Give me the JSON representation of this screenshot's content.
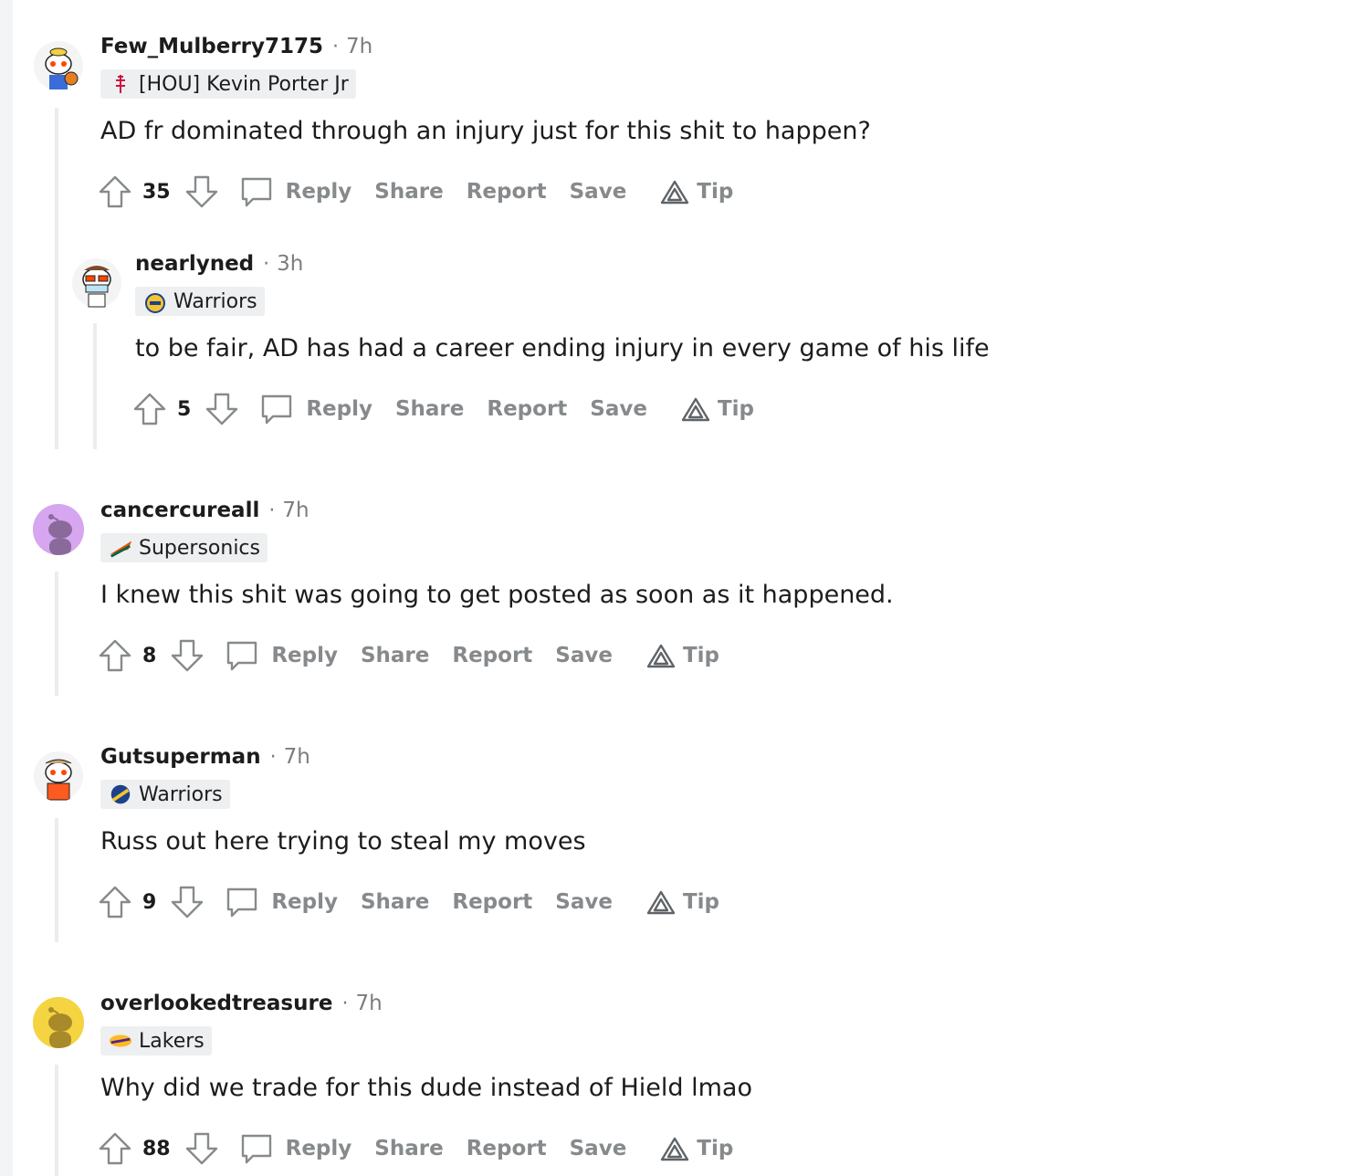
{
  "actions": {
    "reply": "Reply",
    "share": "Share",
    "report": "Report",
    "save": "Save",
    "tip": "Tip"
  },
  "comments": [
    {
      "username": "Few_Mulberry7175",
      "age": "7h",
      "flair": "[HOU] Kevin Porter Jr",
      "flair_icon": "rockets-logo-icon",
      "body": "AD fr dominated through an injury just for this shit to happen?",
      "score": "35",
      "avatar_color": "#ffffff"
    },
    {
      "username": "nearlyned",
      "age": "3h",
      "flair": "Warriors",
      "flair_icon": "bay-warriors-logo-icon",
      "body": "to be fair, AD has had a career ending injury in every game of his life",
      "score": "5",
      "avatar_color": "#ffffff"
    },
    {
      "username": "cancercureall",
      "age": "7h",
      "flair": "Supersonics",
      "flair_icon": "supersonics-logo-icon",
      "body": "I knew this shit was going to get posted as soon as it happened.",
      "score": "8",
      "avatar_color": "#d6a6f0"
    },
    {
      "username": "Gutsuperman",
      "age": "7h",
      "flair": "Warriors",
      "flair_icon": "warriors-logo-icon",
      "body": "Russ out here trying to steal my moves",
      "score": "9",
      "avatar_color": "#ffffff"
    },
    {
      "username": "overlookedtreasure",
      "age": "7h",
      "flair": "Lakers",
      "flair_icon": "lakers-logo-icon",
      "body": "Why did we trade for this dude instead of Hield lmao",
      "score": "88",
      "avatar_color": "#f5d442"
    }
  ]
}
